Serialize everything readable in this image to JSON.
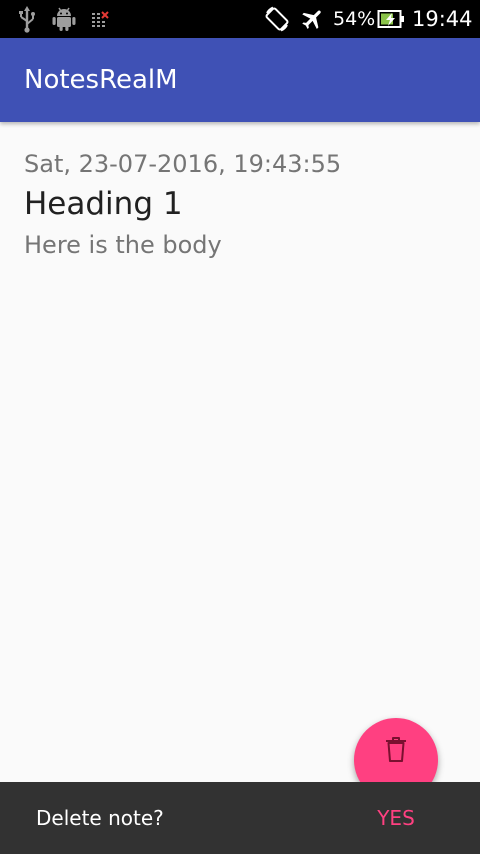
{
  "status_bar": {
    "icons": [
      "usb-icon",
      "android-icon",
      "sim-card-icon",
      "screen-rotation-icon",
      "airplane-mode-icon",
      "battery-charging-icon"
    ],
    "battery_percent": "54%",
    "time": "19:44"
  },
  "app_bar": {
    "title": "NotesRealM",
    "color": "#3f51b5"
  },
  "notes": [
    {
      "date": "Sat, 23-07-2016, 19:43:55",
      "heading": "Heading 1",
      "body": "Here is the body"
    }
  ],
  "fab": {
    "icon": "trash-icon",
    "color": "#ff4081"
  },
  "snackbar": {
    "message": "Delete note?",
    "action_label": "YES",
    "action_color": "#ff4081"
  }
}
